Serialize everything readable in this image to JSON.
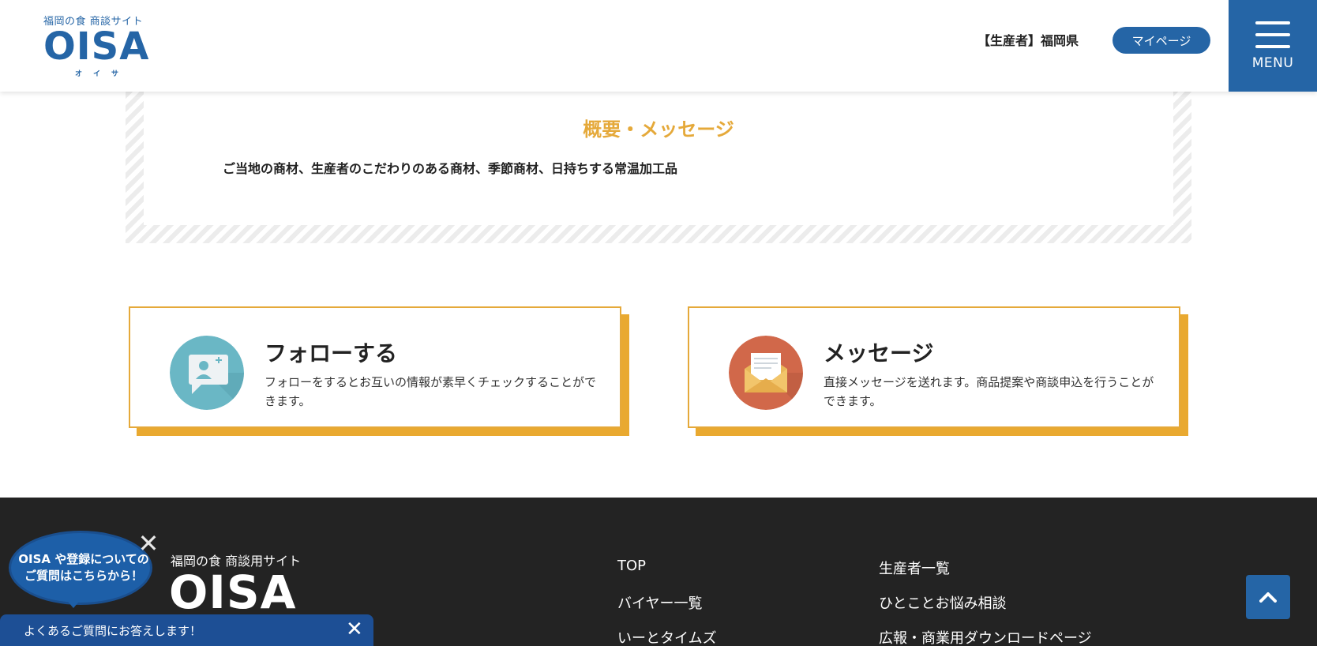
{
  "header": {
    "logo_sub": "福岡の食 商談サイト",
    "logo_main": "OISA",
    "logo_kana": "オイサ",
    "user_role": "【生産者】福岡県",
    "mypage_label": "マイページ",
    "menu_label": "MENU"
  },
  "summary": {
    "title": "概要・メッセージ",
    "text": "ご当地の商材、生産者のこだわりのある商材、季節商材、日持ちする常温加工品"
  },
  "cards": [
    {
      "title": "フォローする",
      "description": "フォローをするとお互いの情報が素早くチェックすることができます。",
      "icon": "follow-user-chat-icon"
    },
    {
      "title": "メッセージ",
      "description": "直接メッセージを送れます。商品提案や商談申込を行うことができます。",
      "icon": "envelope-icon"
    }
  ],
  "footer": {
    "logo_sub": "福岡の食 商談用サイト",
    "logo_main": "OISA",
    "links_col1": [
      "TOP",
      "バイヤー一覧",
      "いーとタイムズ"
    ],
    "links_col2": [
      "生産者一覧",
      "ひとことお悩み相談",
      "広報・商業用ダウンロードページ"
    ]
  },
  "chat": {
    "bubble_line1": "OISA や登録についての",
    "bubble_line2": "ご質問はこちらから！",
    "faq_text": "よくあるご質問にお答えします！"
  },
  "colors": {
    "primary": "#2565a6",
    "accent": "#e5a93a",
    "footer": "#232323"
  }
}
